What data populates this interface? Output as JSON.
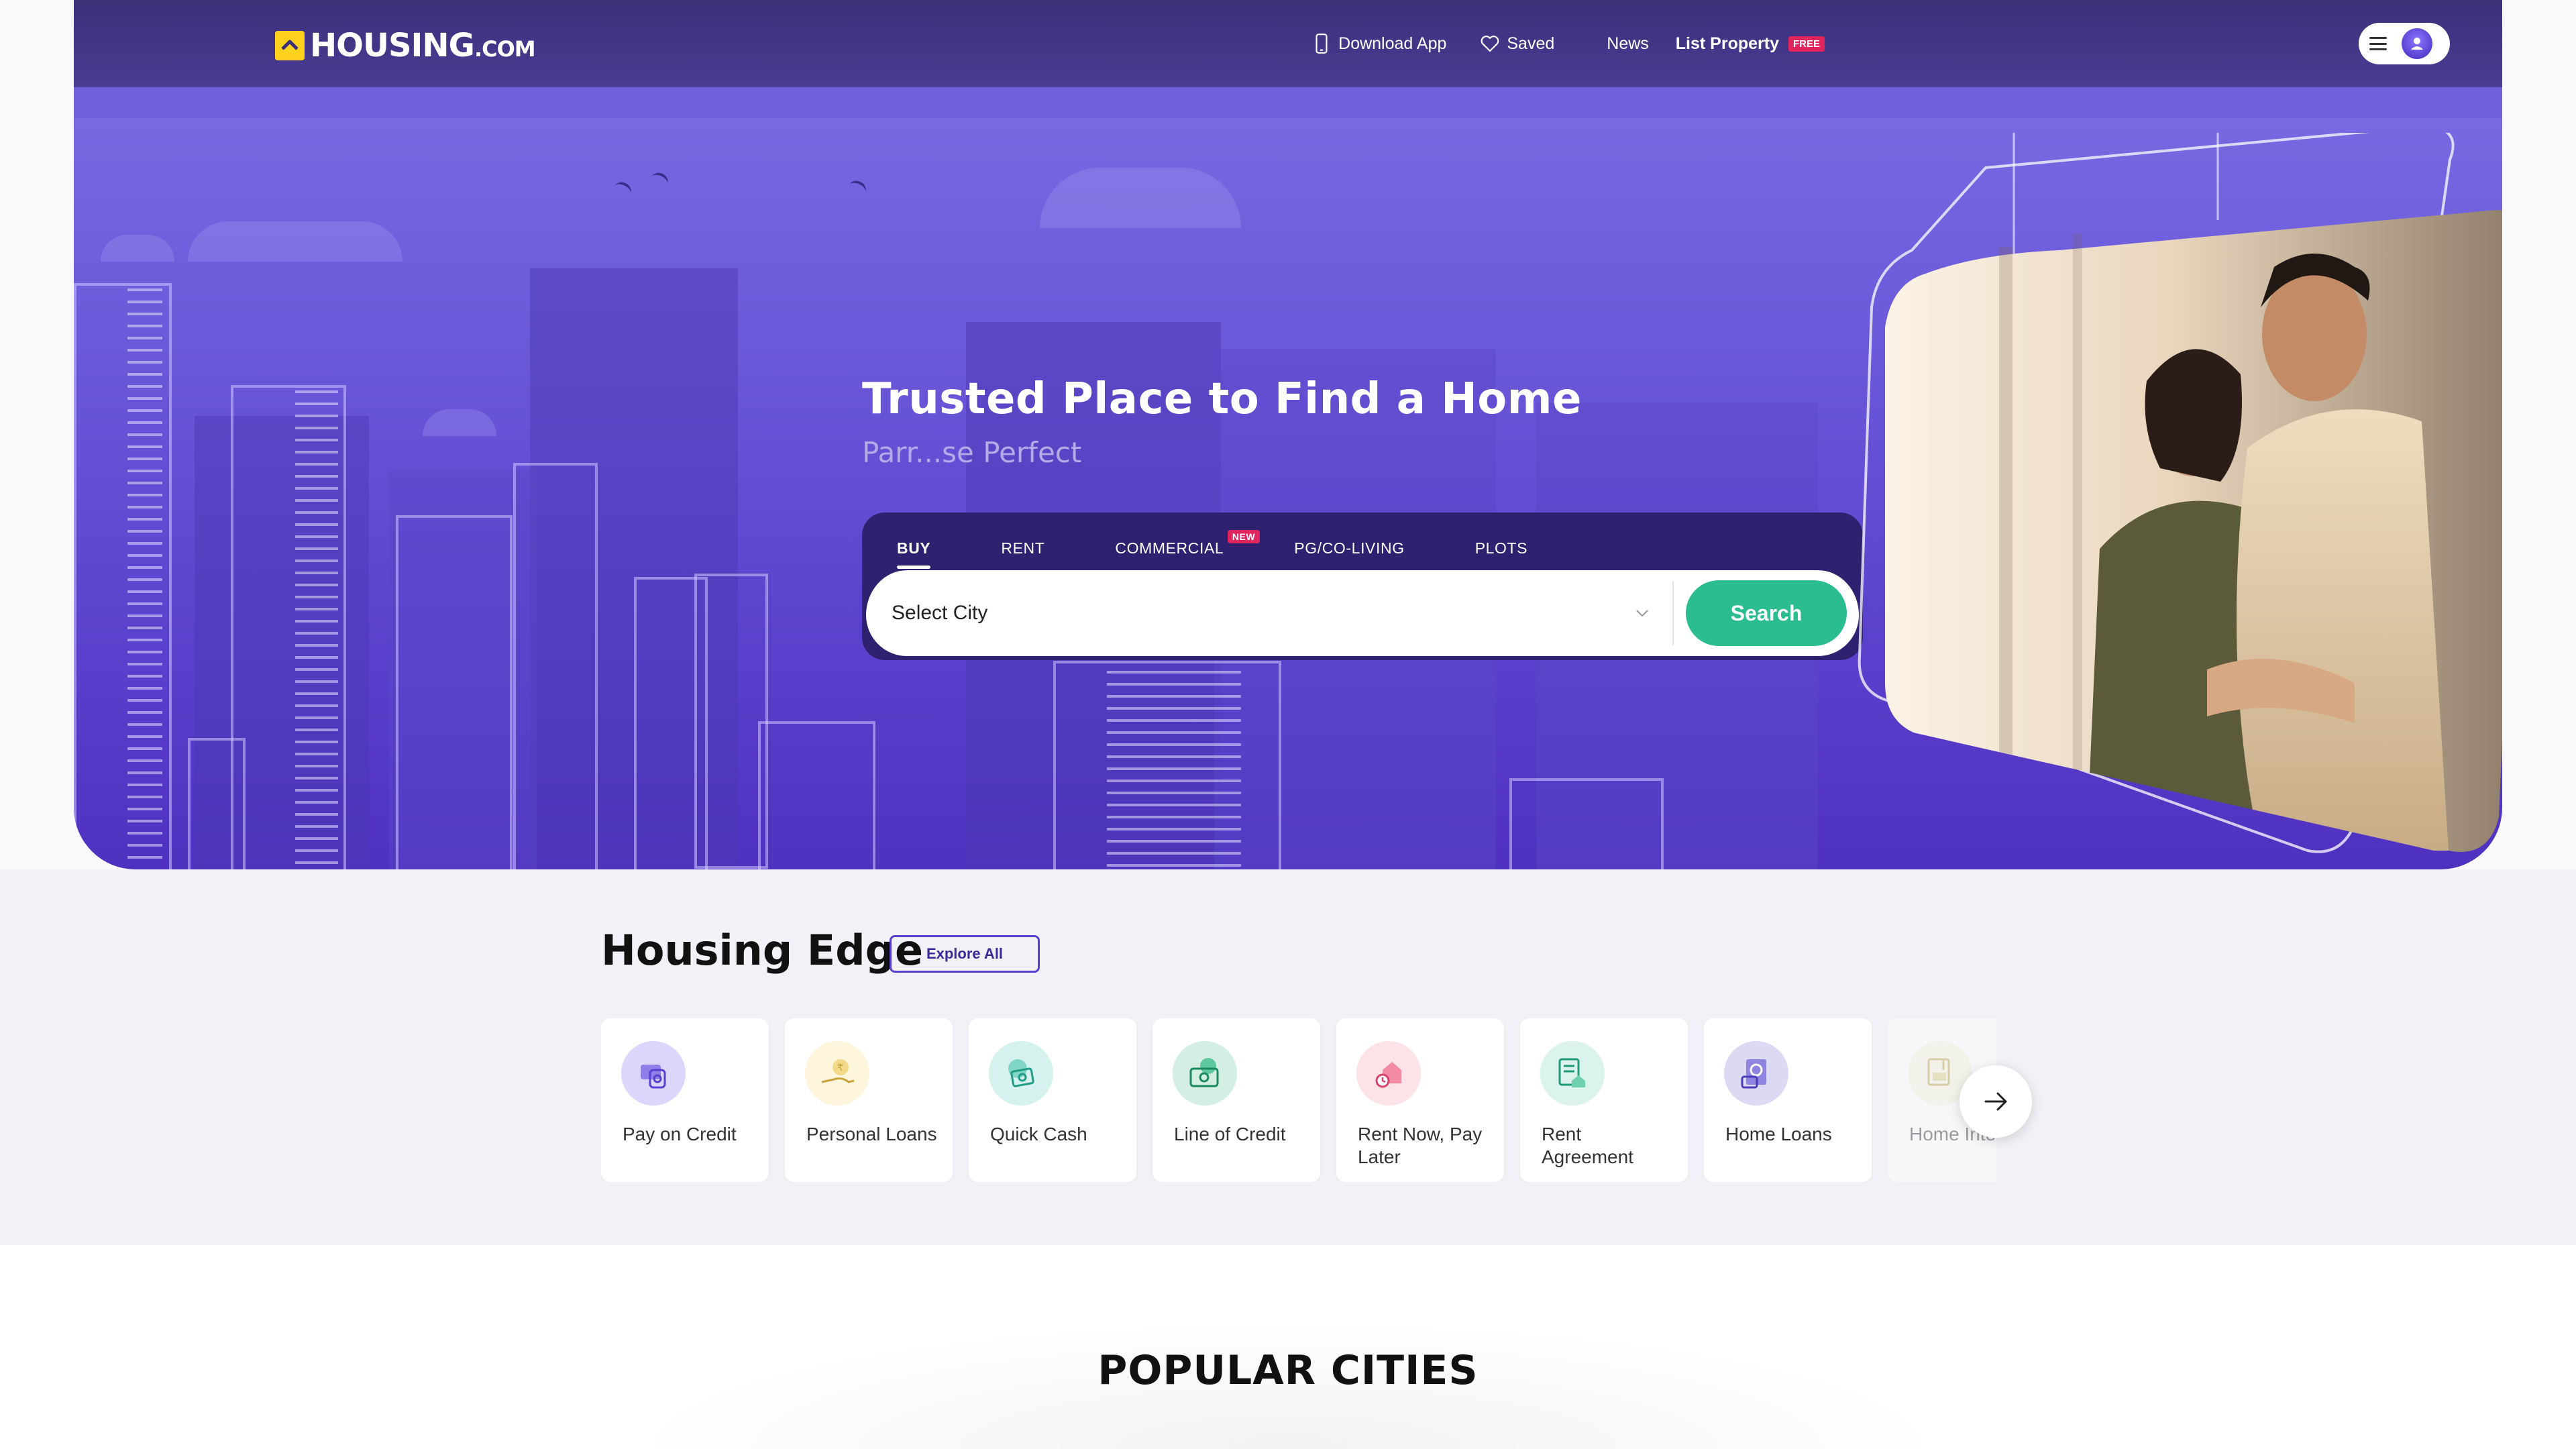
{
  "brand": {
    "name": "HOUSING",
    "suffix": ".COM"
  },
  "nav": {
    "download_app": "Download App",
    "saved": "Saved",
    "news": "News",
    "list_property": "List Property",
    "free_badge": "FREE"
  },
  "hero": {
    "title": "Trusted Place to Find a Home",
    "subtitle": "Parr...se Perfect"
  },
  "search": {
    "tabs": [
      {
        "label": "BUY",
        "active": true
      },
      {
        "label": "RENT"
      },
      {
        "label": "COMMERCIAL",
        "badge": "NEW"
      },
      {
        "label": "PG/CO-LIVING"
      },
      {
        "label": "PLOTS"
      }
    ],
    "city_placeholder": "Select City",
    "button_label": "Search"
  },
  "housing_edge": {
    "title_light": "Housing",
    "title_bold": "Edge",
    "explore_all": "Explore All",
    "cards": [
      {
        "label": "Pay on Credit",
        "icon": "credit-card-hand-icon",
        "color": "#dcd6fb"
      },
      {
        "label": "Personal Loans",
        "icon": "rupee-coin-hand-icon",
        "color": "#fdf6dc"
      },
      {
        "label": "Quick Cash",
        "icon": "cash-icon",
        "color": "#d6f2ee"
      },
      {
        "label": "Line of Credit",
        "icon": "banknote-icon",
        "color": "#d3efe3"
      },
      {
        "label": "Rent Now, Pay Later",
        "icon": "house-clock-icon",
        "color": "#fde2e8"
      },
      {
        "label": "Rent Agreement",
        "icon": "document-house-icon",
        "color": "#dbf3ec"
      },
      {
        "label": "Home Loans",
        "icon": "loan-document-icon",
        "color": "#dcd9f5"
      },
      {
        "label": "Home Interiors",
        "icon": "interiors-icon",
        "color": "#f4f2dc"
      }
    ]
  },
  "popular_cities": {
    "title_light": "POPULAR",
    "title_bold": "CITIES"
  },
  "colors": {
    "primary": "#5a3fd0",
    "search_green": "#2bbd8f",
    "badge_pink": "#e0245e",
    "logo_yellow": "#ffd31d"
  }
}
